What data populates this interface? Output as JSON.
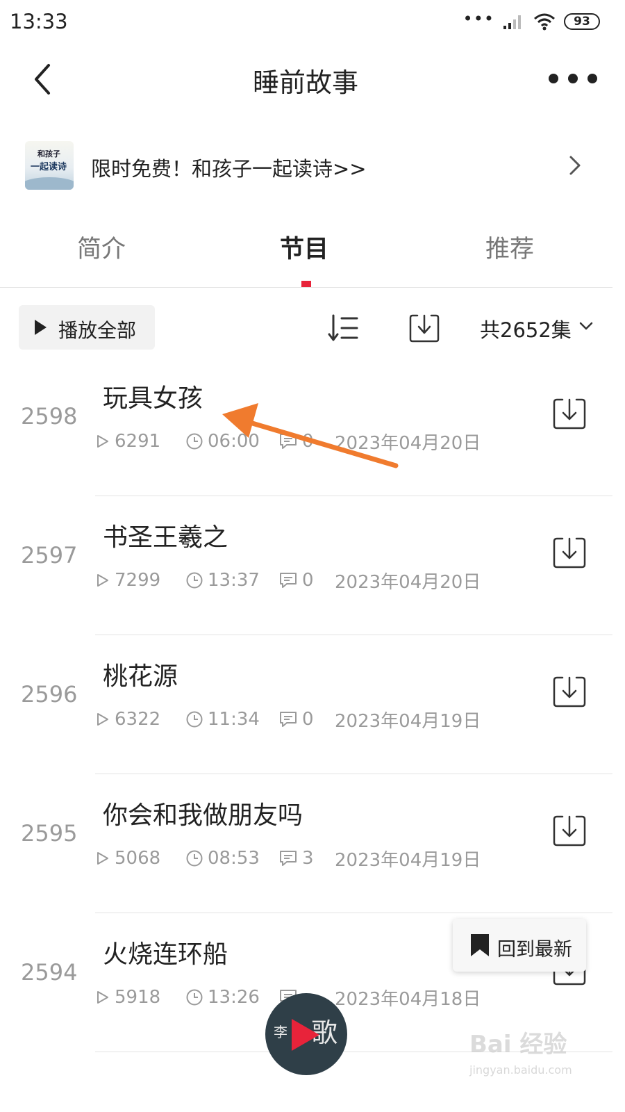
{
  "status_bar": {
    "time": "13:33",
    "signal_dots": "•••",
    "battery": "93"
  },
  "header": {
    "title": "睡前故事"
  },
  "promo": {
    "thumb_line1": "和孩子",
    "thumb_line2": "一起读诗",
    "text": "限时免费！和孩子一起读诗>>"
  },
  "tabs": [
    {
      "label": "简介",
      "active": false
    },
    {
      "label": "节目",
      "active": true
    },
    {
      "label": "推荐",
      "active": false
    }
  ],
  "toolbar": {
    "play_all": "播放全部",
    "episode_count": "共2652集"
  },
  "episodes": [
    {
      "num": "2598",
      "title": "玩具女孩",
      "plays": "6291",
      "duration": "06:00",
      "comments": "0",
      "date": "2023年04月20日"
    },
    {
      "num": "2597",
      "title": "书圣王羲之",
      "plays": "7299",
      "duration": "13:37",
      "comments": "0",
      "date": "2023年04月20日"
    },
    {
      "num": "2596",
      "title": "桃花源",
      "plays": "6322",
      "duration": "11:34",
      "comments": "0",
      "date": "2023年04月19日"
    },
    {
      "num": "2595",
      "title": "你会和我做朋友吗",
      "plays": "5068",
      "duration": "08:53",
      "comments": "3",
      "date": "2023年04月19日"
    },
    {
      "num": "2594",
      "title": "火烧连环船",
      "plays": "5918",
      "duration": "13:26",
      "comments": "",
      "date": "2023年04月18日"
    }
  ],
  "back_to_latest": "回到最新",
  "player": {
    "text_left": "李",
    "text_right": "歌"
  },
  "watermark": {
    "line1": "Bai 经验",
    "line2": "jingyan.baidu.com"
  },
  "colors": {
    "accent": "#e8233a",
    "annotation_arrow": "#f07b2e",
    "secondary_text": "#9a9a9a"
  }
}
